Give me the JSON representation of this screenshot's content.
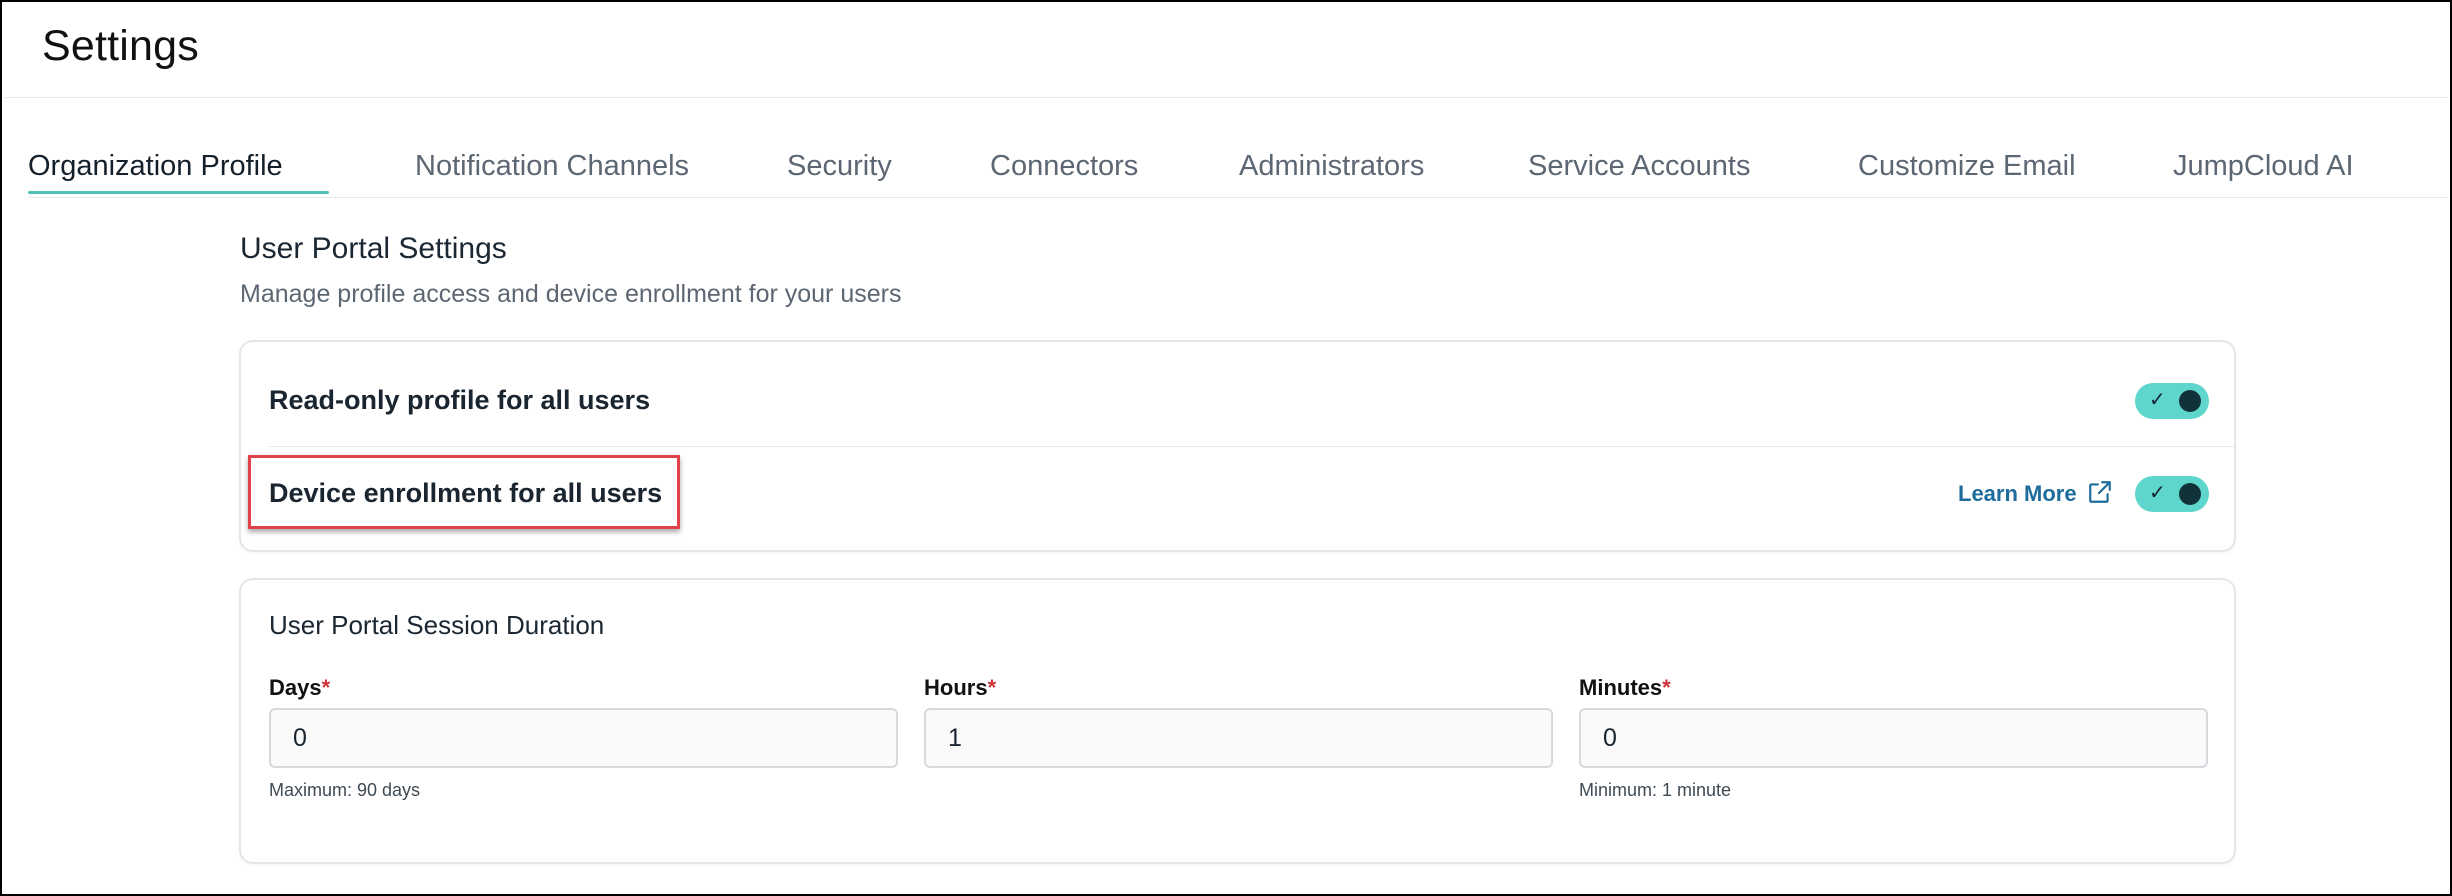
{
  "header": {
    "title": "Settings"
  },
  "tabs": [
    {
      "label": "Organization Profile",
      "active": true
    },
    {
      "label": "Notification Channels",
      "active": false
    },
    {
      "label": "Security",
      "active": false
    },
    {
      "label": "Connectors",
      "active": false
    },
    {
      "label": "Administrators",
      "active": false
    },
    {
      "label": "Service Accounts",
      "active": false
    },
    {
      "label": "Customize Email",
      "active": false
    },
    {
      "label": "JumpCloud AI",
      "active": false
    }
  ],
  "section": {
    "title": "User Portal Settings",
    "description": "Manage profile access and device enrollment for your users"
  },
  "toggles": [
    {
      "label": "Read-only profile for all users",
      "enabled": true
    },
    {
      "label": "Device enrollment for all users",
      "enabled": true,
      "link_label": "Learn More",
      "link_icon": "external-link-icon"
    }
  ],
  "session": {
    "title": "User Portal Session Duration",
    "fields": [
      {
        "label": "Days",
        "required": "*",
        "value": "0",
        "hint": "Maximum: 90 days"
      },
      {
        "label": "Hours",
        "required": "*",
        "value": "1",
        "hint": ""
      },
      {
        "label": "Minutes",
        "required": "*",
        "value": "0",
        "hint": "Minimum: 1 minute"
      }
    ]
  },
  "colors": {
    "accent": "#4cc1b4",
    "toggle_on": "#5fd6cb",
    "link": "#1e6c9c",
    "required": "#d0323a",
    "highlight": "#e0434a"
  }
}
